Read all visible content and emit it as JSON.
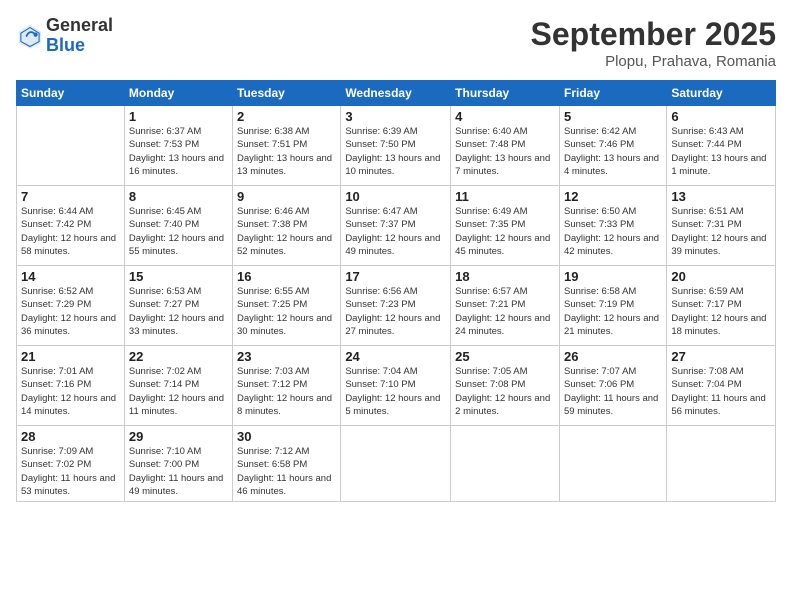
{
  "logo": {
    "general": "General",
    "blue": "Blue"
  },
  "title": {
    "month": "September 2025",
    "location": "Plopu, Prahava, Romania"
  },
  "weekdays": [
    "Sunday",
    "Monday",
    "Tuesday",
    "Wednesday",
    "Thursday",
    "Friday",
    "Saturday"
  ],
  "weeks": [
    [
      {
        "day": "",
        "sunrise": "",
        "sunset": "",
        "daylight": ""
      },
      {
        "day": "1",
        "sunrise": "Sunrise: 6:37 AM",
        "sunset": "Sunset: 7:53 PM",
        "daylight": "Daylight: 13 hours and 16 minutes."
      },
      {
        "day": "2",
        "sunrise": "Sunrise: 6:38 AM",
        "sunset": "Sunset: 7:51 PM",
        "daylight": "Daylight: 13 hours and 13 minutes."
      },
      {
        "day": "3",
        "sunrise": "Sunrise: 6:39 AM",
        "sunset": "Sunset: 7:50 PM",
        "daylight": "Daylight: 13 hours and 10 minutes."
      },
      {
        "day": "4",
        "sunrise": "Sunrise: 6:40 AM",
        "sunset": "Sunset: 7:48 PM",
        "daylight": "Daylight: 13 hours and 7 minutes."
      },
      {
        "day": "5",
        "sunrise": "Sunrise: 6:42 AM",
        "sunset": "Sunset: 7:46 PM",
        "daylight": "Daylight: 13 hours and 4 minutes."
      },
      {
        "day": "6",
        "sunrise": "Sunrise: 6:43 AM",
        "sunset": "Sunset: 7:44 PM",
        "daylight": "Daylight: 13 hours and 1 minute."
      }
    ],
    [
      {
        "day": "7",
        "sunrise": "Sunrise: 6:44 AM",
        "sunset": "Sunset: 7:42 PM",
        "daylight": "Daylight: 12 hours and 58 minutes."
      },
      {
        "day": "8",
        "sunrise": "Sunrise: 6:45 AM",
        "sunset": "Sunset: 7:40 PM",
        "daylight": "Daylight: 12 hours and 55 minutes."
      },
      {
        "day": "9",
        "sunrise": "Sunrise: 6:46 AM",
        "sunset": "Sunset: 7:38 PM",
        "daylight": "Daylight: 12 hours and 52 minutes."
      },
      {
        "day": "10",
        "sunrise": "Sunrise: 6:47 AM",
        "sunset": "Sunset: 7:37 PM",
        "daylight": "Daylight: 12 hours and 49 minutes."
      },
      {
        "day": "11",
        "sunrise": "Sunrise: 6:49 AM",
        "sunset": "Sunset: 7:35 PM",
        "daylight": "Daylight: 12 hours and 45 minutes."
      },
      {
        "day": "12",
        "sunrise": "Sunrise: 6:50 AM",
        "sunset": "Sunset: 7:33 PM",
        "daylight": "Daylight: 12 hours and 42 minutes."
      },
      {
        "day": "13",
        "sunrise": "Sunrise: 6:51 AM",
        "sunset": "Sunset: 7:31 PM",
        "daylight": "Daylight: 12 hours and 39 minutes."
      }
    ],
    [
      {
        "day": "14",
        "sunrise": "Sunrise: 6:52 AM",
        "sunset": "Sunset: 7:29 PM",
        "daylight": "Daylight: 12 hours and 36 minutes."
      },
      {
        "day": "15",
        "sunrise": "Sunrise: 6:53 AM",
        "sunset": "Sunset: 7:27 PM",
        "daylight": "Daylight: 12 hours and 33 minutes."
      },
      {
        "day": "16",
        "sunrise": "Sunrise: 6:55 AM",
        "sunset": "Sunset: 7:25 PM",
        "daylight": "Daylight: 12 hours and 30 minutes."
      },
      {
        "day": "17",
        "sunrise": "Sunrise: 6:56 AM",
        "sunset": "Sunset: 7:23 PM",
        "daylight": "Daylight: 12 hours and 27 minutes."
      },
      {
        "day": "18",
        "sunrise": "Sunrise: 6:57 AM",
        "sunset": "Sunset: 7:21 PM",
        "daylight": "Daylight: 12 hours and 24 minutes."
      },
      {
        "day": "19",
        "sunrise": "Sunrise: 6:58 AM",
        "sunset": "Sunset: 7:19 PM",
        "daylight": "Daylight: 12 hours and 21 minutes."
      },
      {
        "day": "20",
        "sunrise": "Sunrise: 6:59 AM",
        "sunset": "Sunset: 7:17 PM",
        "daylight": "Daylight: 12 hours and 18 minutes."
      }
    ],
    [
      {
        "day": "21",
        "sunrise": "Sunrise: 7:01 AM",
        "sunset": "Sunset: 7:16 PM",
        "daylight": "Daylight: 12 hours and 14 minutes."
      },
      {
        "day": "22",
        "sunrise": "Sunrise: 7:02 AM",
        "sunset": "Sunset: 7:14 PM",
        "daylight": "Daylight: 12 hours and 11 minutes."
      },
      {
        "day": "23",
        "sunrise": "Sunrise: 7:03 AM",
        "sunset": "Sunset: 7:12 PM",
        "daylight": "Daylight: 12 hours and 8 minutes."
      },
      {
        "day": "24",
        "sunrise": "Sunrise: 7:04 AM",
        "sunset": "Sunset: 7:10 PM",
        "daylight": "Daylight: 12 hours and 5 minutes."
      },
      {
        "day": "25",
        "sunrise": "Sunrise: 7:05 AM",
        "sunset": "Sunset: 7:08 PM",
        "daylight": "Daylight: 12 hours and 2 minutes."
      },
      {
        "day": "26",
        "sunrise": "Sunrise: 7:07 AM",
        "sunset": "Sunset: 7:06 PM",
        "daylight": "Daylight: 11 hours and 59 minutes."
      },
      {
        "day": "27",
        "sunrise": "Sunrise: 7:08 AM",
        "sunset": "Sunset: 7:04 PM",
        "daylight": "Daylight: 11 hours and 56 minutes."
      }
    ],
    [
      {
        "day": "28",
        "sunrise": "Sunrise: 7:09 AM",
        "sunset": "Sunset: 7:02 PM",
        "daylight": "Daylight: 11 hours and 53 minutes."
      },
      {
        "day": "29",
        "sunrise": "Sunrise: 7:10 AM",
        "sunset": "Sunset: 7:00 PM",
        "daylight": "Daylight: 11 hours and 49 minutes."
      },
      {
        "day": "30",
        "sunrise": "Sunrise: 7:12 AM",
        "sunset": "Sunset: 6:58 PM",
        "daylight": "Daylight: 11 hours and 46 minutes."
      },
      {
        "day": "",
        "sunrise": "",
        "sunset": "",
        "daylight": ""
      },
      {
        "day": "",
        "sunrise": "",
        "sunset": "",
        "daylight": ""
      },
      {
        "day": "",
        "sunrise": "",
        "sunset": "",
        "daylight": ""
      },
      {
        "day": "",
        "sunrise": "",
        "sunset": "",
        "daylight": ""
      }
    ]
  ]
}
